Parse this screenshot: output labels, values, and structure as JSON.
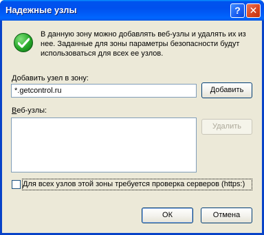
{
  "window": {
    "title": "Надежные узлы",
    "help_glyph": "?",
    "close_glyph": "✕"
  },
  "info": {
    "icon": "green-check-icon",
    "lines": [
      "В данную зону можно добавлять веб-узлы и удалять их из",
      "нее. Заданные для зоны параметры безопасности будут",
      "использоваться для всех ее узлов."
    ]
  },
  "add_site": {
    "label_prefix": "Д",
    "label_rest": "обавить узел в зону:",
    "value": "*.getcontrol.ru",
    "add_button": "Добавить"
  },
  "sites": {
    "label_prefix": "В",
    "label_rest": "еб-узлы:",
    "items": [],
    "remove_button": "Удалить"
  },
  "require_https": {
    "checked": false,
    "label": "Для всех узлов этой зоны требуется проверка серверов (https:)"
  },
  "footer": {
    "ok_button": "ОК",
    "cancel_button": "Отмена"
  },
  "colors": {
    "titlebar": "#0055e5",
    "dialog_bg": "#ece9d8",
    "check_green": "#27a82a"
  }
}
